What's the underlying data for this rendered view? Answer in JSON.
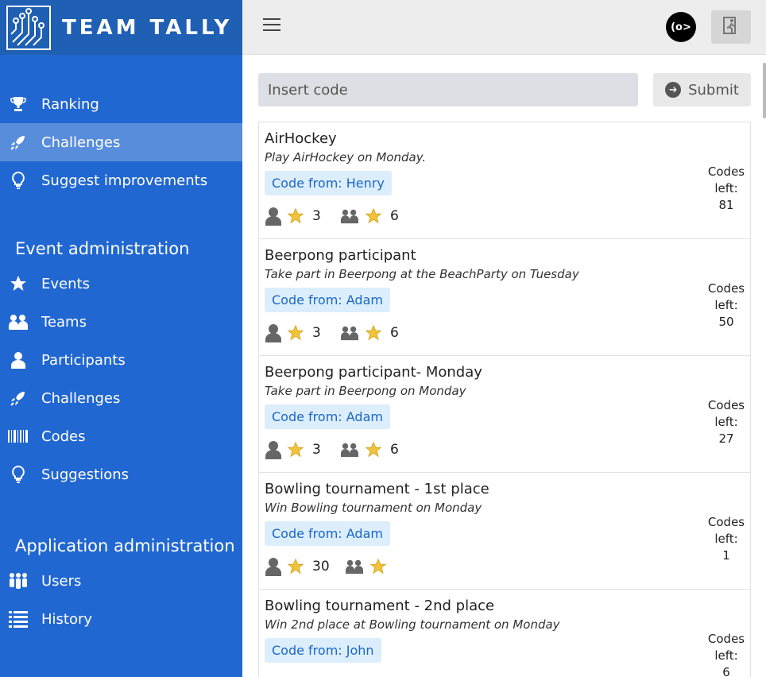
{
  "app": {
    "title": "TEAM TALLY"
  },
  "nav": {
    "main": [
      {
        "label": "Ranking",
        "icon": "trophy-icon",
        "active": false
      },
      {
        "label": "Challenges",
        "icon": "rocket-icon",
        "active": true
      },
      {
        "label": "Suggest improvements",
        "icon": "lightbulb-icon",
        "active": false
      }
    ],
    "event_admin_title": "Event administration",
    "event_admin": [
      {
        "label": "Events",
        "icon": "star-icon"
      },
      {
        "label": "Teams",
        "icon": "team-icon"
      },
      {
        "label": "Participants",
        "icon": "user-icon"
      },
      {
        "label": "Challenges",
        "icon": "rocket-icon"
      },
      {
        "label": "Codes",
        "icon": "barcode-icon"
      },
      {
        "label": "Suggestions",
        "icon": "lightbulb-icon"
      }
    ],
    "app_admin_title": "Application administration",
    "app_admin": [
      {
        "label": "Users",
        "icon": "users-icon"
      },
      {
        "label": "History",
        "icon": "list-icon"
      }
    ]
  },
  "topbar": {
    "avatar_text": "(o>"
  },
  "form": {
    "placeholder": "Insert code",
    "submit_label": "Submit"
  },
  "challenges": [
    {
      "title": "AirHockey",
      "desc": "Play AirHockey on Monday.",
      "code_from": "Code from: Henry",
      "single_pts": "3",
      "team_pts": "6",
      "codes_left_label": "Codes left:",
      "codes_left": "81"
    },
    {
      "title": "Beerpong participant",
      "desc": "Take part in Beerpong at the BeachParty on Tuesday",
      "code_from": "Code from: Adam",
      "single_pts": "3",
      "team_pts": "6",
      "codes_left_label": "Codes left:",
      "codes_left": "50"
    },
    {
      "title": "Beerpong participant- Monday",
      "desc": "Take part in Beerpong on Monday",
      "code_from": "Code from: Adam",
      "single_pts": "3",
      "team_pts": "6",
      "codes_left_label": "Codes left:",
      "codes_left": "27"
    },
    {
      "title": "Bowling tournament - 1st place",
      "desc": "Win Bowling tournament on Monday",
      "code_from": "Code from: Adam",
      "single_pts": "30",
      "team_pts": "",
      "codes_left_label": "Codes left:",
      "codes_left": "1"
    },
    {
      "title": "Bowling tournament - 2nd place",
      "desc": "Win 2nd place at Bowling tournament on Monday",
      "code_from": "Code from: John",
      "single_pts": "",
      "team_pts": "",
      "codes_left_label": "Codes left:",
      "codes_left": "6"
    }
  ]
}
